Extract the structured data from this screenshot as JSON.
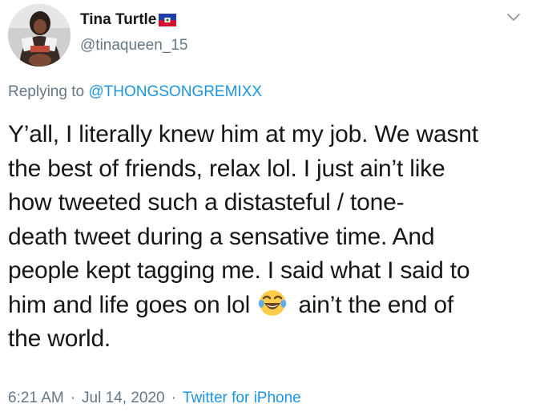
{
  "author": {
    "display_name": "Tina Turtle",
    "handle": "@tinaqueen_15",
    "flag_icon": "haiti-flag-emoji",
    "avatar_icon": "profile-photo"
  },
  "reply": {
    "prefix": "Replying to ",
    "mention": "@THONGSONGREMIXX"
  },
  "tweet": {
    "lines": [
      "Y’all, I literally knew him at my job. We wasnt",
      "the best of friends, relax lol. I just ain’t like",
      "how tweeted such a distasteful / tone-",
      "death tweet during a sensative time. And",
      "people kept tagging me. I said what I said to"
    ],
    "line6_before_emoji": "him and life goes on lol ",
    "emoji": "face-with-tears-of-joy",
    "line6_after_emoji": " ain’t the end of",
    "line7": "the world."
  },
  "meta": {
    "time": "6:21 AM",
    "separator": "·",
    "date": "Jul 14, 2020",
    "source": "Twitter for iPhone"
  },
  "colors": {
    "text": "#14171a",
    "secondary": "#657786",
    "link": "#1b95e0"
  }
}
